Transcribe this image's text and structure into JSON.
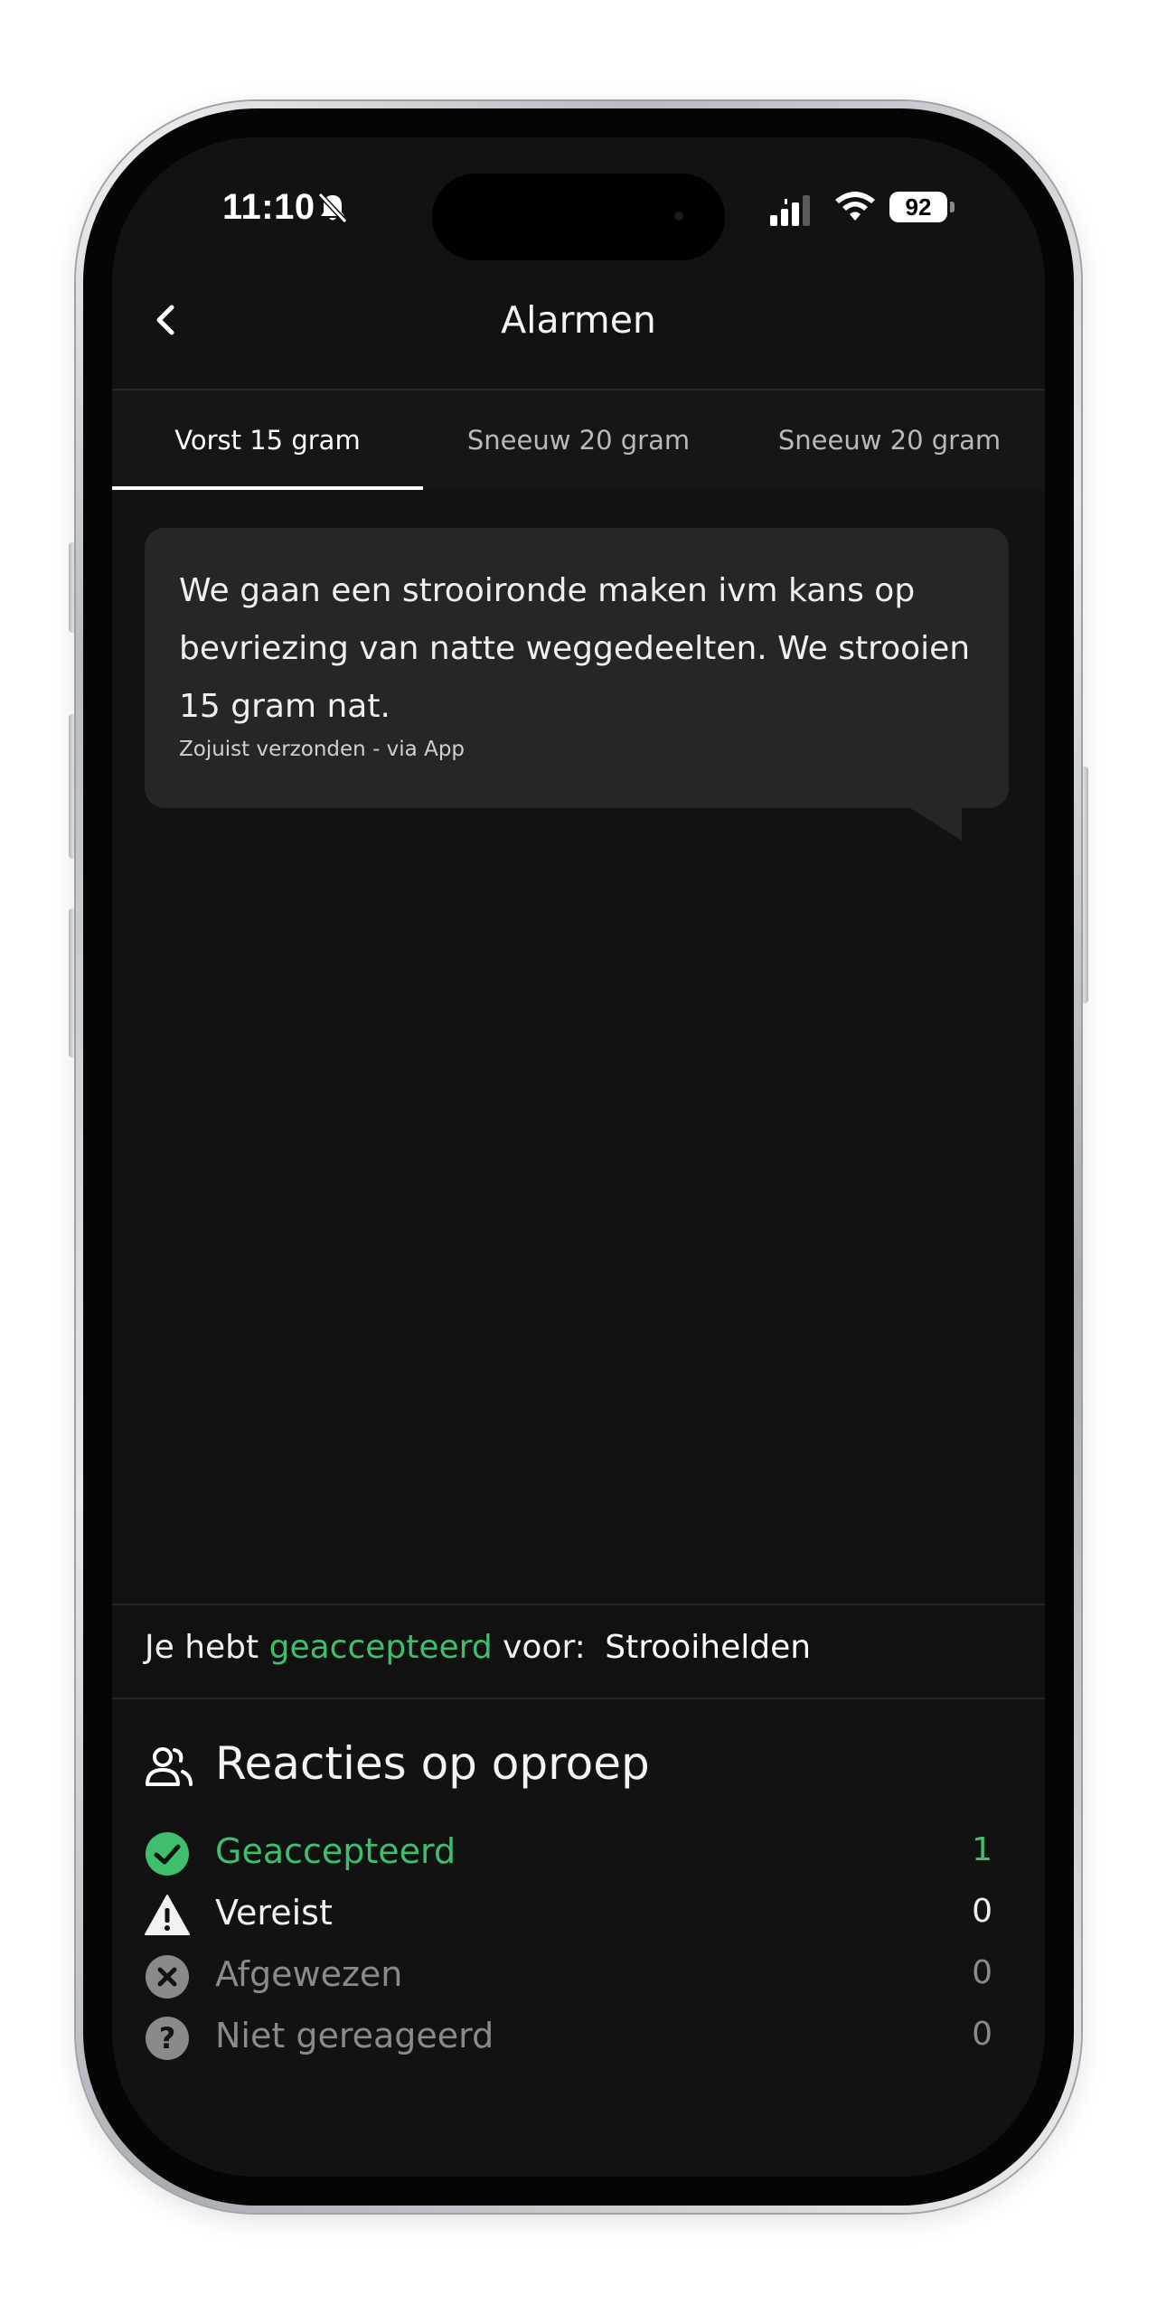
{
  "status_bar": {
    "time": "11:10",
    "battery": "92",
    "icons": [
      "bell-slash-icon",
      "signal-icon",
      "wifi-icon",
      "battery-icon"
    ]
  },
  "header": {
    "title": "Alarmen",
    "back_icon": "chevron-left-icon"
  },
  "tabs": [
    {
      "label": "Vorst 15 gram",
      "active": true
    },
    {
      "label": "Sneeuw 20 gram",
      "active": false
    },
    {
      "label": "Sneeuw 20 gram",
      "active": false
    }
  ],
  "message": {
    "text": "We gaan een strooironde maken ivm kans op bevriezing van natte weggedeelten. We strooien 15 gram nat.",
    "meta": "Zojuist verzonden - via App"
  },
  "acceptance": {
    "prefix": "Je hebt",
    "status": "geaccepteerd",
    "middle": "voor:",
    "organization": "Strooihelden"
  },
  "reactions": {
    "title": "Reacties op oproep",
    "header_icon": "users-icon",
    "items": [
      {
        "label": "Geaccepteerd",
        "count": "1",
        "icon": "check-circle-icon",
        "color": "#3fbf6d"
      },
      {
        "label": "Vereist",
        "count": "0",
        "icon": "warning-triangle-icon",
        "color": "#f2f2f2"
      },
      {
        "label": "Afgewezen",
        "count": "0",
        "icon": "x-circle-icon",
        "color": "#8a8a8a"
      },
      {
        "label": "Niet gereageerd",
        "count": "0",
        "icon": "question-circle-icon",
        "color": "#8a8a8a"
      }
    ]
  }
}
